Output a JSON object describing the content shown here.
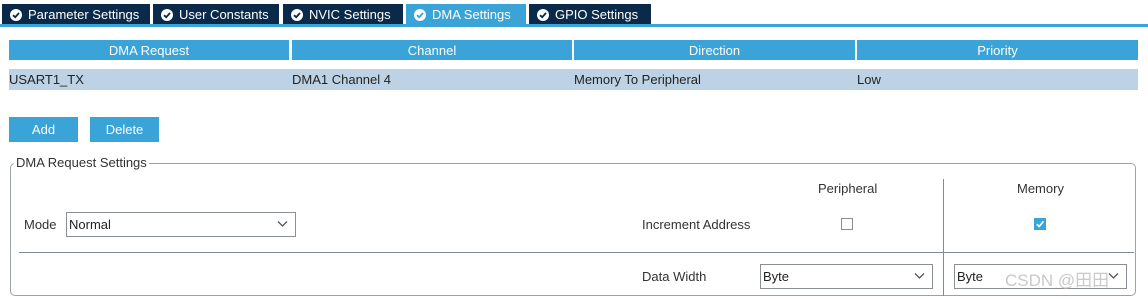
{
  "tabs": [
    {
      "label": "Parameter Settings"
    },
    {
      "label": "User Constants"
    },
    {
      "label": "NVIC Settings"
    },
    {
      "label": "DMA Settings"
    },
    {
      "label": "GPIO Settings"
    }
  ],
  "active_tab": "DMA Settings",
  "table": {
    "headers": [
      "DMA Request",
      "Channel",
      "Direction",
      "Priority"
    ],
    "rows": [
      [
        "USART1_TX",
        "DMA1 Channel 4",
        "Memory To Peripheral",
        "Low"
      ]
    ]
  },
  "buttons": {
    "add": "Add",
    "delete": "Delete"
  },
  "settings": {
    "group_title": "DMA Request Settings",
    "mode_label": "Mode",
    "mode_value": "Normal",
    "peripheral_header": "Peripheral",
    "memory_header": "Memory",
    "increment_label": "Increment Address",
    "peripheral_increment": false,
    "memory_increment": true,
    "data_width_label": "Data Width",
    "peripheral_width": "Byte",
    "memory_width": "Byte"
  },
  "watermark": "CSDN @田田",
  "colors": {
    "accent": "#3aa3d8",
    "tab_dark": "#0b2a4a",
    "row_selected": "#bed2e6"
  },
  "icons": {
    "tab_status": "check-circle-icon",
    "dropdown": "chevron-down-icon",
    "checkbox_mark": "check-icon"
  }
}
